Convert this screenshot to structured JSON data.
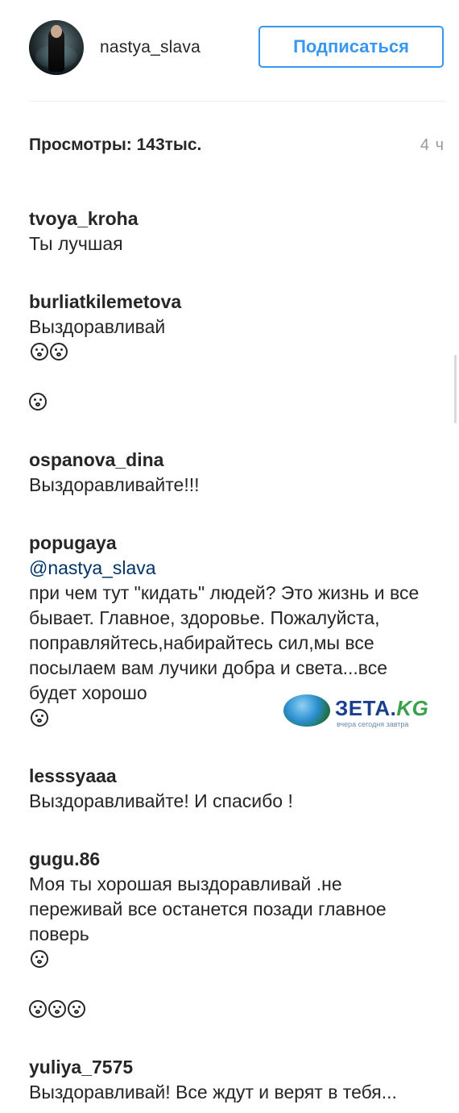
{
  "profile": {
    "username": "nastya_slava",
    "follow_label": "Подписаться"
  },
  "post": {
    "views_text": "Просмотры: 143тыс.",
    "time_ago": "4 ч"
  },
  "comments": [
    {
      "user": "tvoya_kroha",
      "text": "Ты лучшая",
      "emoji_after": 0
    },
    {
      "user": "burliatkilemetova",
      "text": "Выздоравливай",
      "emoji_after": 3
    },
    {
      "user": "ospanova_dina",
      "text": "Выздоравливайте!!!",
      "emoji_after": 0
    },
    {
      "user": "popugaya",
      "mention": "@nastya_slava",
      "text": "при чем тут \"кидать\" людей? Это жизнь и все бывает. Главное, здоровье. Пожалуйста, поправляйтесь,набирайтесь сил,мы все посылаем вам лучики добра и света...все будет хорошо",
      "emoji_after": 1
    },
    {
      "user": "lesssyaaa",
      "text": "Выздоравливайте! И спасибо !",
      "emoji_after": 0
    },
    {
      "user": "gugu.86",
      "text": "Моя ты хорошая выздоравливай .не переживай все останется позади главное поверь",
      "emoji_after": 4
    },
    {
      "user": "yuliya_7575",
      "text": "Выздоравливай! Все ждут и верят в тебя...",
      "emoji_after": 0
    }
  ],
  "watermark": {
    "brand_main": "ЗЕТА.",
    "brand_tld": "KG",
    "tagline": "вчера сегодня завтра"
  },
  "icons": [
    "avatar",
    "face-emoji-icon",
    "globe-logo-icon"
  ],
  "colors": {
    "accent": "#3897f0",
    "text": "#262626",
    "muted": "#999999"
  }
}
